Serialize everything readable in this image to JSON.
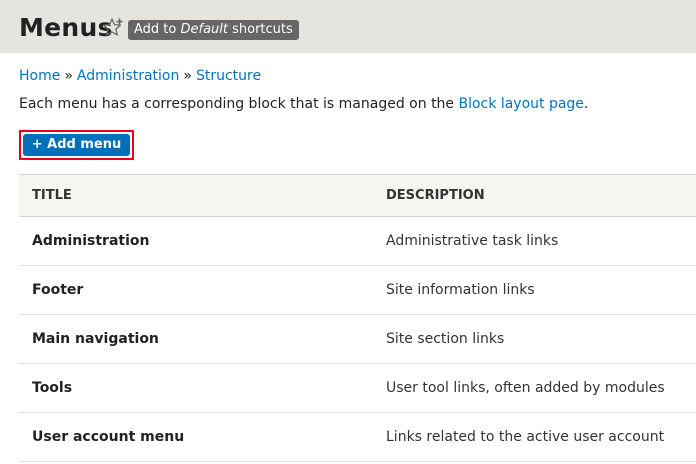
{
  "header": {
    "title": "Menus",
    "star_icon": "star-plus-icon",
    "shortcut_prefix": "Add to ",
    "shortcut_set": "Default",
    "shortcut_suffix": " shortcuts"
  },
  "breadcrumb": {
    "items": [
      "Home",
      "Administration",
      "Structure"
    ],
    "separator": "»"
  },
  "help": {
    "text": "Each menu has a corresponding block that is managed on the ",
    "link": "Block layout page",
    "end": "."
  },
  "actions": {
    "add_menu_label": "+ Add menu",
    "highlight_color": "#e8001c"
  },
  "table": {
    "columns": [
      "TITLE",
      "DESCRIPTION"
    ],
    "rows": [
      {
        "title": "Administration",
        "description": "Administrative task links"
      },
      {
        "title": "Footer",
        "description": "Site information links"
      },
      {
        "title": "Main navigation",
        "description": "Site section links"
      },
      {
        "title": "Tools",
        "description": "User tool links, often added by modules"
      },
      {
        "title": "User account menu",
        "description": "Links related to the active user account"
      }
    ]
  },
  "colors": {
    "link": "#0074bd",
    "button": "#0071b8",
    "header_bg": "#e6e4df",
    "badge_bg": "#666666"
  }
}
